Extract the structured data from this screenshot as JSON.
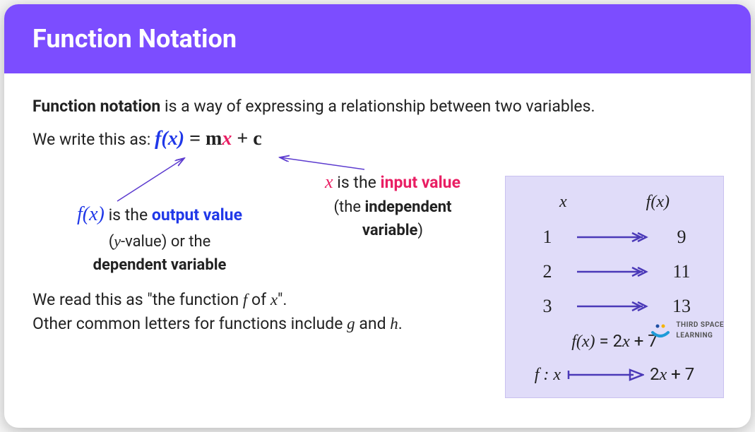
{
  "header": {
    "title": "Function Notation"
  },
  "intro": {
    "term": "Function notation",
    "rest": " is a way of expressing a relationship between two variables."
  },
  "equation": {
    "lead": "We write this as: ",
    "fx": "f(x)",
    "eq": " = m",
    "x": "x",
    "c": " + c"
  },
  "left_annot": {
    "fx": "f(x)",
    "rest1_a": " is the ",
    "rest1_b": "output value",
    "line2_a": "(",
    "line2_y": "y",
    "line2_b": "-value) or the",
    "line3": "dependent variable"
  },
  "right_annot": {
    "x": "x",
    "rest1_a": " is the ",
    "rest1_b": "input value",
    "line2_a": "(the ",
    "line2_b": "independent",
    "line3_a": "variable",
    "line3_b": ")"
  },
  "lower": {
    "line1_a": "We read this as \"the function ",
    "line1_f": "f",
    "line1_b": " of ",
    "line1_x": "x",
    "line1_c": "\".",
    "line2_a": "Other common letters for functions include ",
    "line2_g": "g",
    "line2_b": " and ",
    "line2_h": "h",
    "line2_c": "."
  },
  "mapping": {
    "col1": "x",
    "col2": "f(x)",
    "rows": [
      {
        "x": "1",
        "fx": "9"
      },
      {
        "x": "2",
        "fx": "11"
      },
      {
        "x": "3",
        "fx": "13"
      }
    ],
    "formula_a": "f(x)",
    "formula_b": " = 2",
    "formula_x": "x",
    "formula_c": " + 7",
    "mapsto_a": "f : x",
    "mapsto_b": "2",
    "mapsto_x": "x",
    "mapsto_c": " + 7"
  },
  "logo": {
    "line1": "THIRD SPACE",
    "line2": "LEARNING"
  }
}
